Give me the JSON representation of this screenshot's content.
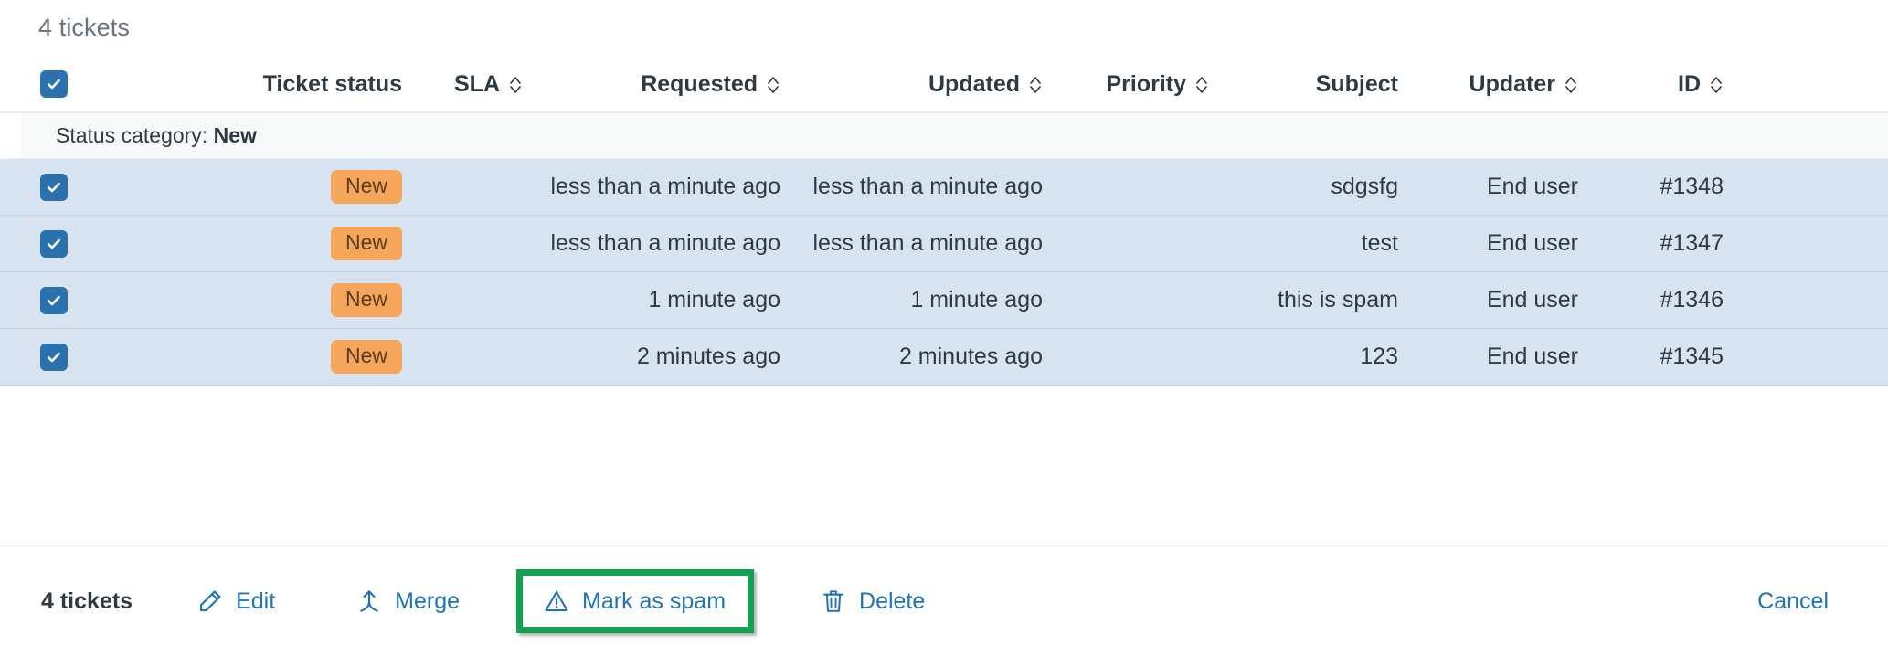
{
  "header": {
    "tickets_count": "4 tickets"
  },
  "table": {
    "select_all_checkbox": true,
    "columns": [
      {
        "label": "",
        "sortable": false,
        "align": "left",
        "name": "select-all"
      },
      {
        "label": "Ticket status",
        "sortable": false,
        "align": "right",
        "name": "ticket-status"
      },
      {
        "label": "SLA",
        "sortable": true,
        "align": "right",
        "name": "sla"
      },
      {
        "label": "Requested",
        "sortable": true,
        "align": "right",
        "name": "requested"
      },
      {
        "label": "Updated",
        "sortable": true,
        "align": "right",
        "name": "updated"
      },
      {
        "label": "Priority",
        "sortable": true,
        "align": "right",
        "name": "priority"
      },
      {
        "label": "Subject",
        "sortable": false,
        "align": "right",
        "name": "subject"
      },
      {
        "label": "Updater",
        "sortable": true,
        "align": "right",
        "name": "updater"
      },
      {
        "label": "ID",
        "sortable": true,
        "align": "right",
        "name": "id"
      }
    ],
    "group": {
      "prefix": "Status category:",
      "value": "New"
    },
    "rows": [
      {
        "checked": true,
        "status": "New",
        "sla": "",
        "requested": "less than a minute ago",
        "updated": "less than a minute ago",
        "priority": "",
        "subject": "sdgsfg",
        "updater": "End user",
        "id": "#1348"
      },
      {
        "checked": true,
        "status": "New",
        "sla": "",
        "requested": "less than a minute ago",
        "updated": "less than a minute ago",
        "priority": "",
        "subject": "test",
        "updater": "End user",
        "id": "#1347"
      },
      {
        "checked": true,
        "status": "New",
        "sla": "",
        "requested": "1 minute ago",
        "updated": "1 minute ago",
        "priority": "",
        "subject": "this is spam",
        "updater": "End user",
        "id": "#1346"
      },
      {
        "checked": true,
        "status": "New",
        "sla": "",
        "requested": "2 minutes ago",
        "updated": "2 minutes ago",
        "priority": "",
        "subject": "123",
        "updater": "End user",
        "id": "#1345"
      }
    ]
  },
  "toolbar": {
    "count_label": "4 tickets",
    "edit_label": "Edit",
    "merge_label": "Merge",
    "spam_label": "Mark as spam",
    "delete_label": "Delete",
    "cancel_label": "Cancel"
  },
  "colors": {
    "link": "#1f73b7",
    "checkbox": "#2b71ad",
    "badge_bg": "#f5a65b",
    "badge_text": "#5a3d1e",
    "row_selected_bg": "#d7e3f1",
    "row_border": "#bcd2e8",
    "group_bg": "#f8f9f9",
    "highlight_border": "#12a150",
    "muted_text": "#68737d",
    "text": "#2f3941"
  }
}
